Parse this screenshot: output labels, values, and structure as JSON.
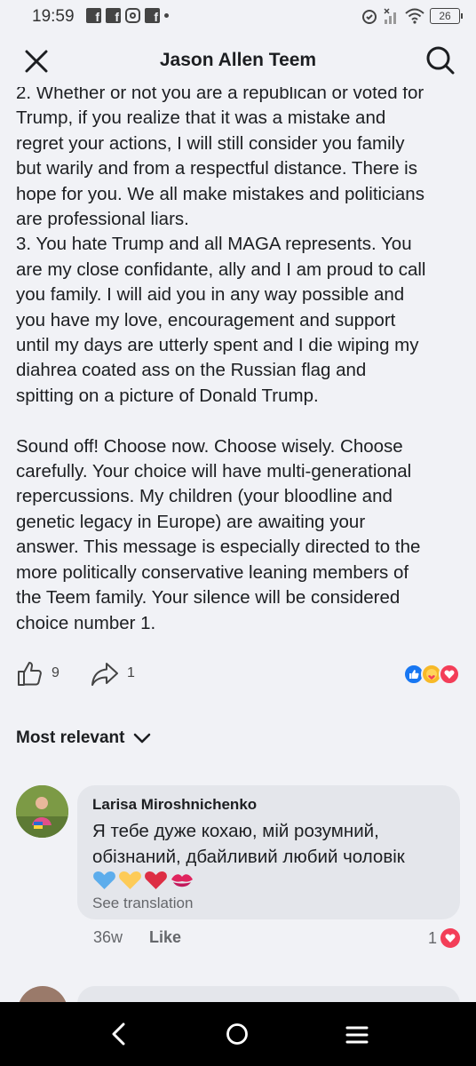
{
  "status_bar": {
    "time": "19:59",
    "battery": "26",
    "left_icons": [
      "facebook-icon",
      "facebook-icon",
      "instagram-icon",
      "facebook-icon",
      "dot-icon"
    ],
    "right_icons": [
      "alarm-icon",
      "cell-signal-icon",
      "wifi-icon",
      "battery-icon"
    ]
  },
  "header": {
    "title": "Jason Allen Teem",
    "close_icon": "close-icon",
    "search_icon": "search-icon"
  },
  "post": {
    "lines": [
      "2. Whether or not you are a republican or voted for",
      "Trump, if you realize that it was a mistake and",
      "regret your actions, I will still consider you family",
      "but warily and from a respectful distance. There is",
      "hope for you. We all make mistakes and politicians",
      "are professional liars.",
      "3. You hate Trump and all MAGA represents. You",
      "are my close confidante, ally and I am proud to call",
      "you family. I will aid you in any way possible and",
      "you have my love, encouragement and support",
      "until my days are utterly spent and I die wiping my",
      "diahrea coated ass on the Russian flag and",
      "spitting on a picture of Donald Trump.",
      "",
      "Sound off! Choose now. Choose wisely. Choose",
      "carefully. Your choice will have multi-generational",
      "repercussions. My children (your bloodline and",
      "genetic legacy in Europe) are awaiting your",
      "answer. This message is especially directed to the",
      "more politically conservative leaning members of",
      "the Teem family. Your silence will be considered",
      "choice number 1."
    ],
    "like_count": "9",
    "share_count": "1",
    "reactions": [
      "like",
      "care",
      "love"
    ]
  },
  "comments_sort": {
    "label": "Most relevant"
  },
  "comment": {
    "author": "Larisa Miroshnichenko",
    "text_line1": "Я тебе дуже кохаю, мій розумний,",
    "text_line2": "обізнаний, дбайливий любий чоловік",
    "emojis": [
      "blue-heart",
      "yellow-heart",
      "red-heart",
      "kiss-mark"
    ],
    "see_translation": "See translation",
    "time": "36w",
    "like_label": "Like",
    "reaction_count": "1"
  },
  "colors": {
    "background": "#f1f2f6",
    "bubble": "#e4e6eb",
    "text": "#1c1e21",
    "secondary": "#65676b",
    "fb_blue": "#1877f2",
    "love_red": "#f33e58"
  }
}
